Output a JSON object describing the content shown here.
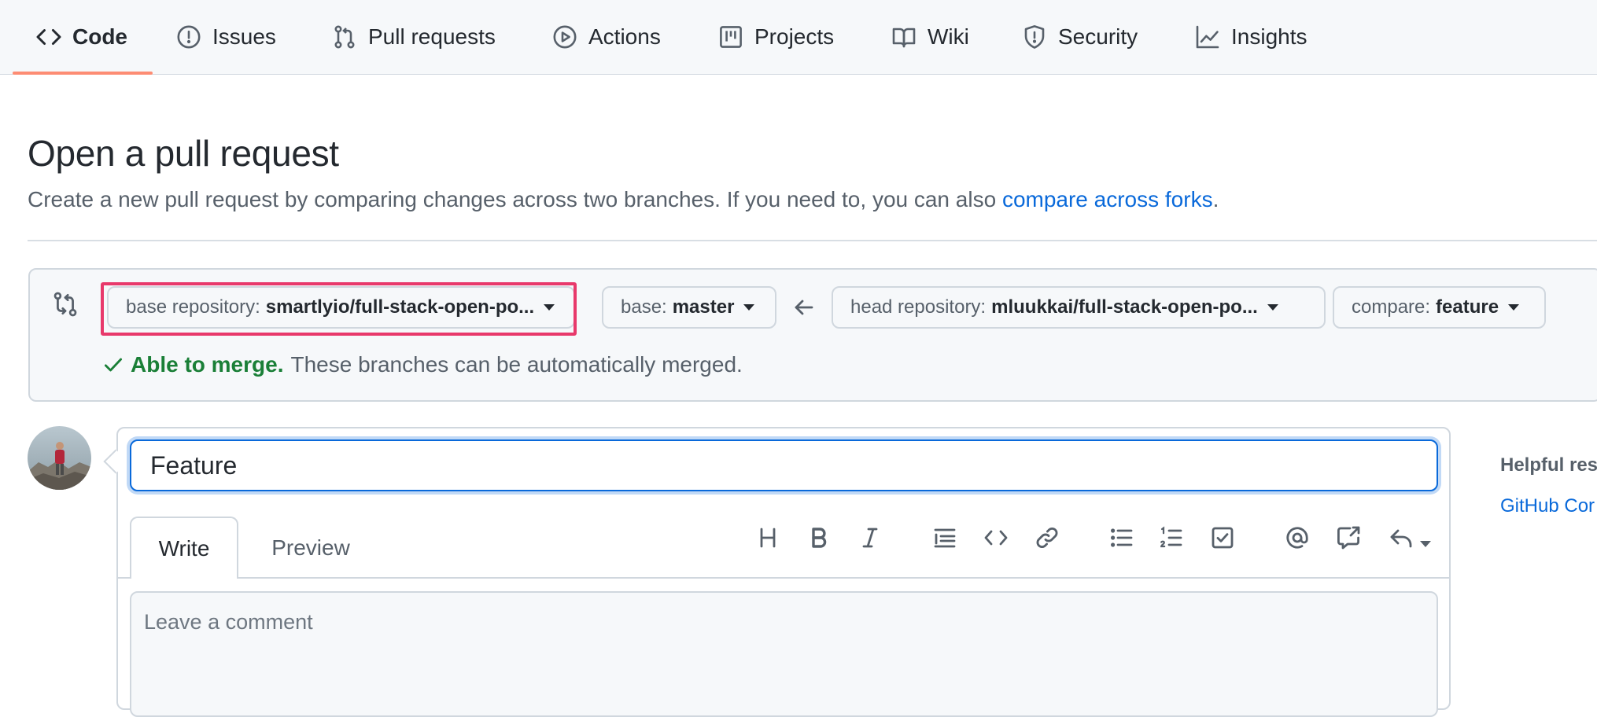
{
  "nav": {
    "tabs": [
      {
        "label": "Code",
        "icon": "code-icon",
        "active": true
      },
      {
        "label": "Issues",
        "icon": "issue-icon"
      },
      {
        "label": "Pull requests",
        "icon": "git-pull-request-icon"
      },
      {
        "label": "Actions",
        "icon": "play-icon"
      },
      {
        "label": "Projects",
        "icon": "project-icon"
      },
      {
        "label": "Wiki",
        "icon": "book-icon"
      },
      {
        "label": "Security",
        "icon": "shield-icon"
      },
      {
        "label": "Insights",
        "icon": "graph-icon"
      }
    ],
    "active_underline_color": "#fd8c73"
  },
  "header": {
    "title": "Open a pull request",
    "subtitle_text": "Create a new pull request by comparing changes across two branches. If you need to, you can also ",
    "subtitle_link": "compare across forks",
    "subtitle_end": "."
  },
  "compare": {
    "base_repo": {
      "label": "base repository:",
      "value": "smartlyio/full-stack-open-po..."
    },
    "base": {
      "label": "base:",
      "value": "master"
    },
    "head_repo": {
      "label": "head repository:",
      "value": "mluukkai/full-stack-open-po..."
    },
    "compare": {
      "label": "compare:",
      "value": "feature"
    },
    "merge_status_strong": "Able to merge.",
    "merge_status_text": "These branches can be automatically merged.",
    "highlight_color": "#e8396b"
  },
  "form": {
    "title_value": "Feature",
    "tabs": {
      "write": "Write",
      "preview": "Preview"
    },
    "comment_placeholder": "Leave a comment"
  },
  "sidebar": {
    "heading": "Helpful res",
    "link": "GitHub Cor"
  },
  "colors": {
    "link": "#0969da",
    "success": "#1a7f37",
    "focus": "#0969da"
  }
}
